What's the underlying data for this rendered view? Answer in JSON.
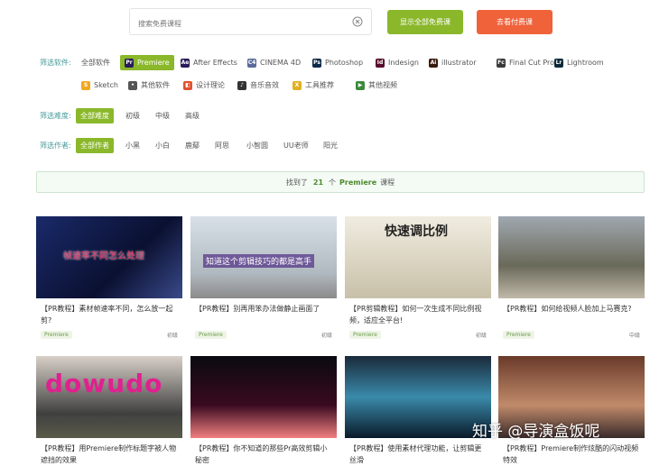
{
  "search": {
    "placeholder": "搜索免费课程",
    "clear_icon": "close-circle-icon"
  },
  "actions": {
    "show_free": "显示全部免费课",
    "paid": "去看付费课"
  },
  "filters": {
    "software_label": "筛选软件:",
    "software": [
      {
        "label": "全部软件",
        "icon": ""
      },
      {
        "label": "Premiere",
        "icon": "Pr",
        "color": "#2a1a5a",
        "active": true
      },
      {
        "label": "After Effects",
        "icon": "Ae",
        "color": "#2a1a5a"
      },
      {
        "label": "CINEMA 4D",
        "icon": "C4",
        "color": "#5a6a9a"
      },
      {
        "label": "Photoshop",
        "icon": "Ps",
        "color": "#0a2a4a"
      },
      {
        "label": "Indesign",
        "icon": "Id",
        "color": "#5a0a2a"
      },
      {
        "label": "illustrator",
        "icon": "Ai",
        "color": "#3a1a0a"
      },
      {
        "label": "Final Cut Pro",
        "icon": "Fc",
        "color": "#3a3a3a"
      },
      {
        "label": "Lightroom",
        "icon": "Lr",
        "color": "#0a2a3a"
      }
    ],
    "software_row2": [
      {
        "label": "Sketch",
        "icon": "S",
        "color": "#f0a820"
      },
      {
        "label": "其他软件",
        "icon": "•",
        "color": "#555"
      },
      {
        "label": "设计理论",
        "icon": "◧",
        "color": "#e05030"
      },
      {
        "label": "音乐音效",
        "icon": "♪",
        "color": "#333"
      },
      {
        "label": "工具推荐",
        "icon": "X",
        "color": "#e0b020"
      },
      {
        "label": "其他视频",
        "icon": "▶",
        "color": "#3a8a3a"
      }
    ],
    "difficulty_label": "筛选难度:",
    "difficulty": [
      "全部难度",
      "初级",
      "中级",
      "高级"
    ],
    "author_label": "筛选作者:",
    "authors": [
      "全部作者",
      "小黑",
      "小白",
      "鹿鄢",
      "阿思",
      "小智圆",
      "UU老师",
      "阳光"
    ]
  },
  "result": {
    "prefix": "找到了",
    "count": "21",
    "unit": "个",
    "keyword": "Premiere",
    "suffix": "课程"
  },
  "cards": [
    {
      "title": "【PR教程】素材帧速率不同，怎么放一起剪?",
      "badge": "Premiere",
      "level": "初级",
      "thumb_text": "帧速率不同怎么处理"
    },
    {
      "title": "【PR教程】别再用笨办法做静止画面了",
      "badge": "Premiere",
      "level": "初级",
      "thumb_text": "知道这个剪辑技巧的都是高手"
    },
    {
      "title": "【PR剪辑教程】如何一次生成不同比例视频，适应全平台!",
      "badge": "Premiere",
      "level": "初级",
      "thumb_text": "快速调比例"
    },
    {
      "title": "【PR教程】如何给视频人脸加上马赛克?",
      "badge": "Premiere",
      "level": "中级",
      "thumb_text": ""
    },
    {
      "title": "【PR教程】用Premiere制作标题字被人物遮挡的效果",
      "badge": "",
      "level": "",
      "thumb_text": "dowudo"
    },
    {
      "title": "【PR教程】你不知道的那些Pr高效剪辑小秘密",
      "badge": "",
      "level": "",
      "thumb_text": ""
    },
    {
      "title": "【PR教程】使用素材代理功能，让剪辑更丝滑",
      "badge": "",
      "level": "",
      "thumb_text": ""
    },
    {
      "title": "【PR教程】Premiere制作炫酷的闪动视频特效",
      "badge": "",
      "level": "",
      "thumb_text": ""
    }
  ],
  "watermark": "知乎 @导演盒饭呢"
}
